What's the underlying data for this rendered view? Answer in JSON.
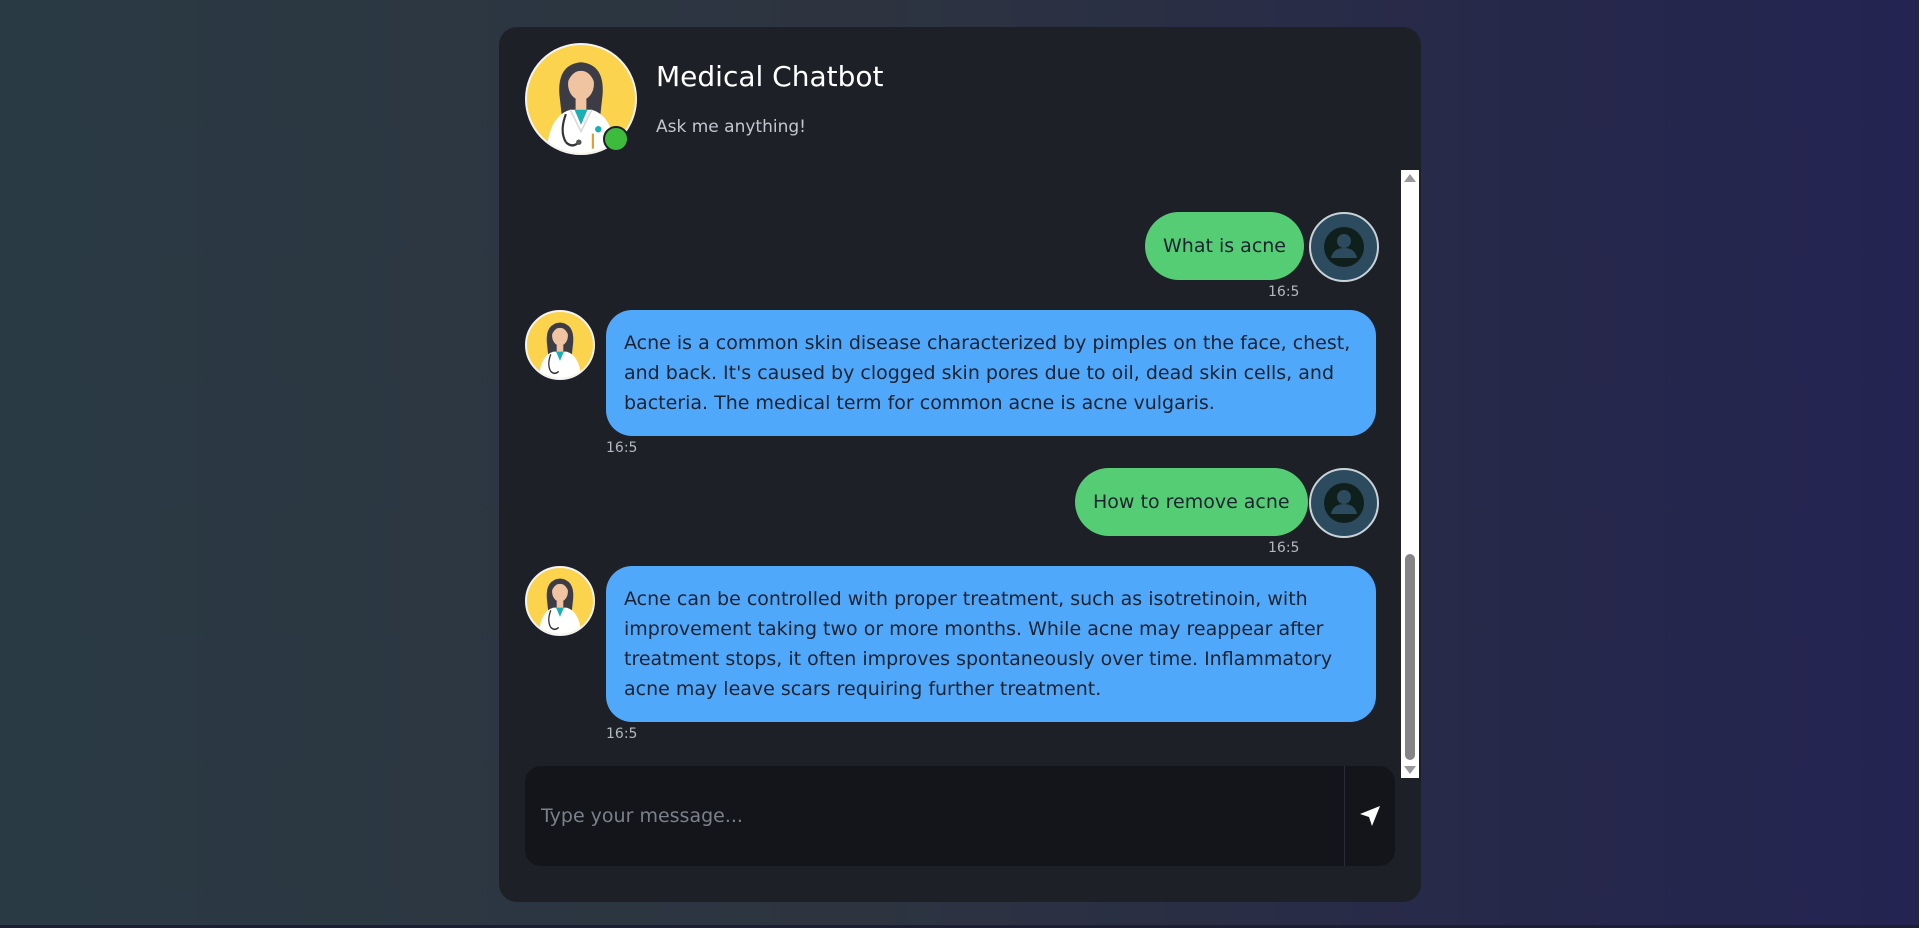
{
  "header": {
    "title": "Medical Chatbot",
    "subtitle": "Ask me anything!",
    "avatar_icon": "doctor-avatar-icon",
    "status": "online"
  },
  "messages": [
    {
      "sender": "user",
      "text": "What is acne",
      "time": "16:5"
    },
    {
      "sender": "bot",
      "text": "Acne is a common skin disease characterized by pimples on the face, chest, and back. It's caused by clogged skin pores due to oil, dead skin cells, and bacteria. The medical term for common acne is acne vulgaris.",
      "time": "16:5"
    },
    {
      "sender": "user",
      "text": "How to remove acne",
      "time": "16:5"
    },
    {
      "sender": "bot",
      "text": "Acne can be controlled with proper treatment, such as isotretinoin, with improvement taking two or more months. While acne may reappear after treatment stops, it often improves spontaneously over time. Inflammatory acne may leave scars requiring further treatment.",
      "time": "16:5"
    }
  ],
  "input": {
    "placeholder": "Type your message...",
    "value": "",
    "send_icon": "send-icon"
  },
  "colors": {
    "user_bubble": "#55cd74",
    "bot_bubble": "#50a8fb",
    "card_background": "#1e2028",
    "online_status": "#3dbb3d",
    "avatar_background": "#fcd34d"
  }
}
